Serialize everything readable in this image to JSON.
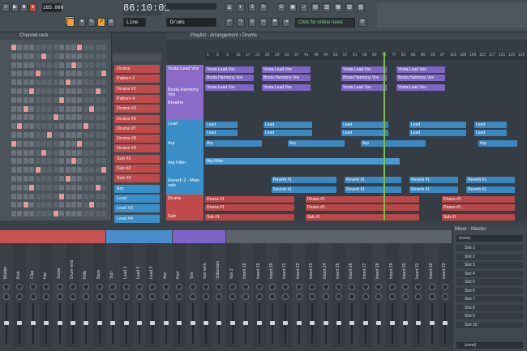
{
  "toolbar": {
    "tempo": "165.000",
    "time_display": "86:10:01",
    "pattern_select": "Drums",
    "snap": "Line",
    "hint_text": "Click for online news",
    "song_label": "SONG",
    "pat_label": "PAT"
  },
  "channel_rack": {
    "title": "Channel rack",
    "rows": 20
  },
  "patterns": [
    {
      "label": "Drums",
      "color": "#c04a4a"
    },
    {
      "label": "Pattern 2",
      "color": "#c04a4a"
    },
    {
      "label": "Drums #2",
      "color": "#c04a4a"
    },
    {
      "label": "Pattern 4",
      "color": "#c04a4a"
    },
    {
      "label": "Drums #3",
      "color": "#c04a4a"
    },
    {
      "label": "Drums #6",
      "color": "#c04a4a"
    },
    {
      "label": "Drums #7",
      "color": "#c04a4a"
    },
    {
      "label": "Drums #8",
      "color": "#c04a4a"
    },
    {
      "label": "Drums #9",
      "color": "#c04a4a"
    },
    {
      "label": "Sub #1",
      "color": "#c04a4a"
    },
    {
      "label": "Sub #2",
      "color": "#c04a4a"
    },
    {
      "label": "Sub #3",
      "color": "#c04a4a"
    },
    {
      "label": "Arp",
      "color": "#3a8fc8"
    },
    {
      "label": "Lead",
      "color": "#3a8fc8"
    },
    {
      "label": "Lead #3",
      "color": "#3a8fc8"
    },
    {
      "label": "Lead #4",
      "color": "#3a8fc8"
    }
  ],
  "playlist": {
    "title": "Playlist - Arrangement › Drums",
    "bar_numbers": [
      "1",
      "5",
      "9",
      "13",
      "17",
      "21",
      "25",
      "29",
      "33",
      "37",
      "41",
      "45",
      "49",
      "53",
      "57",
      "61",
      "65",
      "69",
      "73",
      "77",
      "81",
      "85",
      "89",
      "93",
      "97",
      "101",
      "105",
      "109",
      "113",
      "117",
      "121",
      "125",
      "129"
    ],
    "tracks": [
      {
        "label": "Vosta Lead Vox",
        "color": "#8a6cc8"
      },
      {
        "label": "Bosta Harmony Vox",
        "color": "#8a6cc8"
      },
      {
        "label": "Breathe",
        "color": "#8a6cc8"
      },
      {
        "label": "Lead",
        "color": "#3a8fc8"
      },
      {
        "label": "Arp",
        "color": "#3a8fc8"
      },
      {
        "label": "Arp Filter",
        "color": "#3a8fc8"
      },
      {
        "label": "Reverb 2 - Main ssle",
        "color": "#3a8fc8"
      },
      {
        "label": "Drums",
        "color": "#c04a4a"
      },
      {
        "label": "Sub",
        "color": "#c04a4a"
      }
    ],
    "clip_labels": {
      "vox": "Vosta Lead Vox",
      "harmony": "Bosta Harmony Vox",
      "lead": "Lead",
      "arp": "Arp",
      "arp_filter": "Arp Filter",
      "reverb": "Reverb #1",
      "drums": "Drums #1",
      "sub": "Sub #1"
    }
  },
  "mixer": {
    "title": "Mixer - Master",
    "channel_names": [
      "Master",
      "Kick",
      "Clap",
      "Hat",
      "Snare",
      "Drum verb",
      "Ride",
      "Bass",
      "Sub",
      "Lead 1",
      "Lead 2",
      "Lead 3",
      "Arp",
      "Pad",
      "Vox",
      "Vox verb",
      "Sidechain",
      "Vox 2",
      "Insert 18",
      "Insert 19",
      "Insert 20",
      "Insert 21",
      "Insert 22",
      "Insert 23",
      "Insert 24",
      "Insert 25",
      "Insert 26",
      "Insert 27",
      "Insert 28",
      "Insert 29",
      "Insert 30",
      "Insert 31",
      "Insert 32",
      "Insert 33"
    ],
    "groups": [
      {
        "color": "#c95353"
      },
      {
        "color": "#4a8dcc"
      },
      {
        "color": "#7e64c7"
      },
      {
        "color": "#5c636b"
      }
    ],
    "slots": [
      "Slot 1",
      "Slot 2",
      "Slot 3",
      "Slot 4",
      "Slot 5",
      "Slot 6",
      "Slot 7",
      "Slot 8",
      "Slot 9",
      "Slot 10"
    ],
    "equalizer_label": "Equalizer",
    "none_label": "(none)",
    "output_label": "(none)"
  }
}
